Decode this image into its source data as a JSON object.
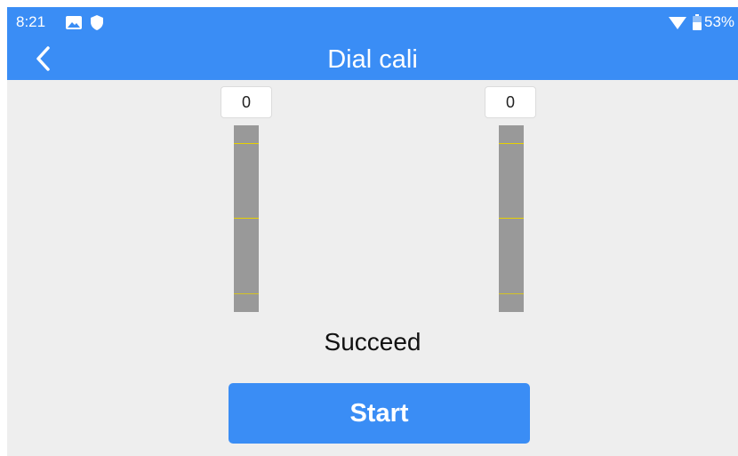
{
  "status_bar": {
    "time": "8:21",
    "icons": [
      "image-icon",
      "shield-icon",
      "wifi-icon",
      "battery-icon"
    ],
    "battery": "53%"
  },
  "header": {
    "back_icon": "chevron-left-icon",
    "title": "Dial cali"
  },
  "dials": [
    {
      "name": "left-dial",
      "value": "0"
    },
    {
      "name": "right-dial",
      "value": "0"
    }
  ],
  "status_message": "Succeed",
  "start_button": {
    "label": "Start"
  },
  "colors": {
    "accent": "#3a8df5",
    "background": "#eeeeee",
    "track": "#999999",
    "tick": "#e8d100"
  }
}
